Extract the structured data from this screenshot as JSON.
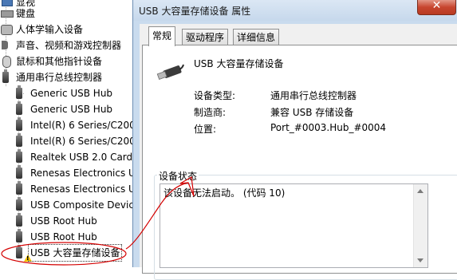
{
  "tree": {
    "items": [
      {
        "label": "显视",
        "icon": "monitor-icon"
      },
      {
        "label": "键盘",
        "icon": "keyboard-icon"
      },
      {
        "label": "人体学输入设备",
        "icon": "hid-icon"
      },
      {
        "label": "声音、视频和游戏控制器",
        "icon": "speaker-icon"
      },
      {
        "label": "鼠标和其他指针设备",
        "icon": "mouse-icon"
      },
      {
        "label": "通用串行总线控制器",
        "icon": "usb-controller-icon",
        "expanded": true
      },
      {
        "label": "Generic USB Hub",
        "icon": "usb-icon"
      },
      {
        "label": "Generic USB Hub",
        "icon": "usb-icon"
      },
      {
        "label": "Intel(R) 6 Series/C200",
        "icon": "usb-icon"
      },
      {
        "label": "Intel(R) 6 Series/C200",
        "icon": "usb-icon"
      },
      {
        "label": "Realtek USB 2.0 Card",
        "icon": "usb-icon"
      },
      {
        "label": "Renesas Electronics U",
        "icon": "usb-icon"
      },
      {
        "label": "Renesas Electronics U",
        "icon": "usb-icon"
      },
      {
        "label": "USB Composite Device",
        "icon": "usb-icon"
      },
      {
        "label": "USB Root Hub",
        "icon": "usb-icon"
      },
      {
        "label": "USB Root Hub",
        "icon": "usb-icon"
      },
      {
        "label": "USB 大容量存储设备",
        "icon": "usb-warning-icon",
        "selected": true
      }
    ]
  },
  "dialog": {
    "title": "USB 大容量存储设备 属性",
    "close_label": "✕",
    "tabs": [
      {
        "label": "常规",
        "active": true
      },
      {
        "label": "驱动程序",
        "active": false
      },
      {
        "label": "详细信息",
        "active": false
      }
    ],
    "device_name": "USB 大容量存储设备",
    "properties": [
      {
        "label": "设备类型:",
        "value": "通用串行总线控制器"
      },
      {
        "label": "制造商:",
        "value": "兼容 USB 存储设备"
      },
      {
        "label": "位置:",
        "value": "Port_#0003.Hub_#0004"
      }
    ],
    "status_group_label": "设备状态",
    "status_text": "该设备无法启动。 (代码 10)"
  },
  "colors": {
    "annotation": "#d40000",
    "warning": "#f5c400",
    "dialog_frame": "#c9dbee"
  }
}
